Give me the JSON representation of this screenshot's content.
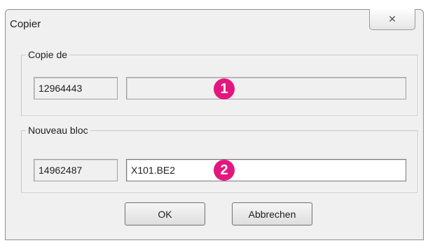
{
  "window": {
    "title": "Copier",
    "close_icon": "close-icon"
  },
  "group_copy_from": {
    "legend": "Copie de",
    "number_value": "12964443",
    "text_value": "",
    "marker": "1"
  },
  "group_new_block": {
    "legend": "Nouveau bloc",
    "number_value": "14962487",
    "text_value": "X101.BE2",
    "marker": "2"
  },
  "buttons": {
    "ok_label": "OK",
    "cancel_label": "Abbrechen"
  },
  "colors": {
    "marker": "#e3177d",
    "dialog_bg": "#f0f0f0"
  }
}
